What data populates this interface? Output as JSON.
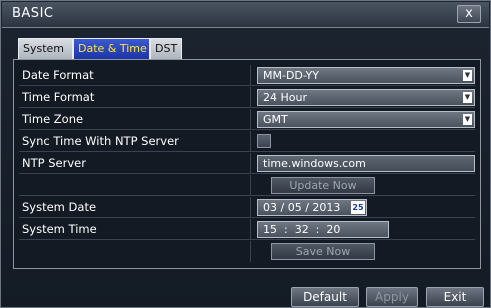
{
  "window": {
    "title": "BASIC",
    "close_label": "x"
  },
  "tabs": [
    {
      "label": "System",
      "active": false
    },
    {
      "label": "Date & Time",
      "active": true
    },
    {
      "label": "DST",
      "active": false
    }
  ],
  "settings": {
    "date_format": {
      "label": "Date Format",
      "value": "MM-DD-YY"
    },
    "time_format": {
      "label": "Time Format",
      "value": "24 Hour"
    },
    "time_zone": {
      "label": "Time Zone",
      "value": "GMT"
    },
    "ntp_sync": {
      "label": "Sync Time With NTP Server",
      "checked": false
    },
    "ntp_server": {
      "label": "NTP Server",
      "value": "time.windows.com"
    },
    "update_now_label": "Update Now",
    "system_date": {
      "label": "System Date",
      "value": "03 / 05 / 2013",
      "calendar_icon_text": "25"
    },
    "system_time": {
      "label": "System Time",
      "value": "15  :  32  :  20"
    },
    "save_now_label": "Save Now"
  },
  "footer": {
    "default_label": "Default",
    "apply_label": "Apply",
    "exit_label": "Exit"
  },
  "icons": {
    "close": "close-icon",
    "dropdown": "chevron-down-icon",
    "calendar": "calendar-icon"
  },
  "colors": {
    "active_tab_bg": "#2a45bd",
    "active_tab_text": "#ffe43a",
    "panel_bg": "#141a24"
  }
}
